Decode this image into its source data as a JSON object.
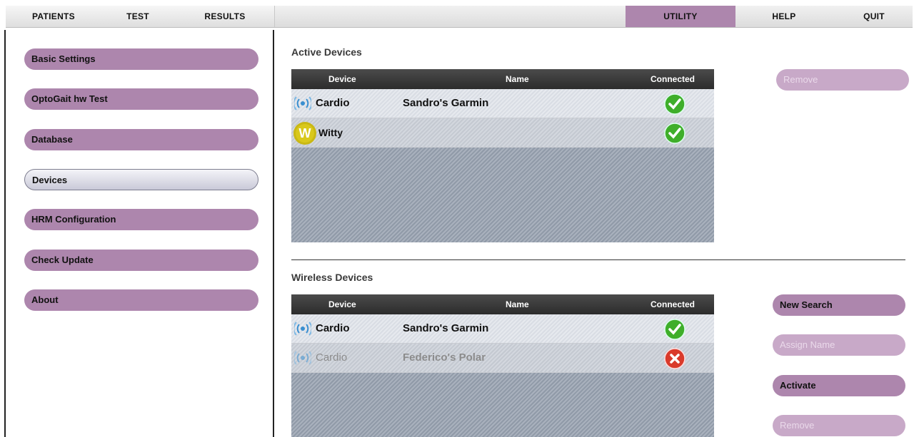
{
  "menu": {
    "left": [
      {
        "label": "PATIENTS"
      },
      {
        "label": "TEST"
      },
      {
        "label": "RESULTS"
      }
    ],
    "right": [
      {
        "label": "UTILITY",
        "active": true
      },
      {
        "label": "HELP"
      },
      {
        "label": "QUIT"
      }
    ]
  },
  "sidebar": {
    "items": [
      {
        "label": "Basic Settings"
      },
      {
        "label": "OptoGait hw Test"
      },
      {
        "label": "Database"
      },
      {
        "label": "Devices",
        "selected": true
      },
      {
        "label": "HRM Configuration"
      },
      {
        "label": "Check Update"
      },
      {
        "label": "About"
      }
    ]
  },
  "active_devices": {
    "title": "Active Devices",
    "columns": [
      "Device",
      "Name",
      "Connected"
    ],
    "rows": [
      {
        "device": "Cardio",
        "icon": "wireless-icon",
        "name": "Sandro's Garmin",
        "connected": true
      },
      {
        "device": "Witty",
        "icon": "witty-logo-icon",
        "name": "",
        "connected": true
      }
    ],
    "remove_label": "Remove"
  },
  "wireless_devices": {
    "title": "Wireless Devices",
    "columns": [
      "Device",
      "Name",
      "Connected"
    ],
    "rows": [
      {
        "device": "Cardio",
        "icon": "wireless-icon",
        "name": "Sandro's Garmin",
        "connected": true
      },
      {
        "device": "Cardio",
        "icon": "wireless-icon",
        "name": "Federico's Polar",
        "connected": false
      }
    ],
    "buttons": {
      "new_search": "New Search",
      "assign_name": "Assign Name",
      "activate": "Activate",
      "remove": "Remove"
    }
  },
  "colors": {
    "accent": "#ad86ad",
    "connected": "#3fae2a",
    "disconnected": "#d93a2b"
  }
}
